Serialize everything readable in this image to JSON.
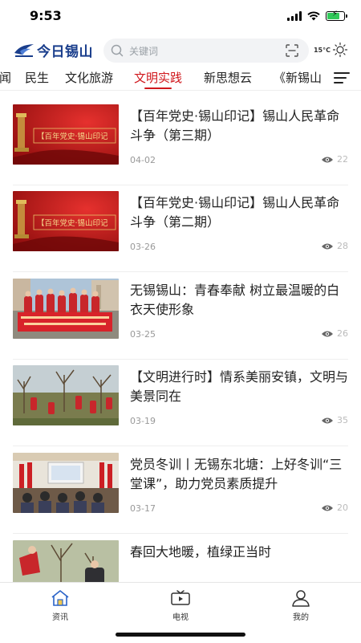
{
  "status_bar": {
    "time": "9:53"
  },
  "header": {
    "logo_text": "今日锡山",
    "search_placeholder": "关键词",
    "weather_temp": "15°C"
  },
  "tabs": [
    {
      "label": "闻"
    },
    {
      "label": "民生"
    },
    {
      "label": "文化旅游"
    },
    {
      "label": "文明实践",
      "active": true
    },
    {
      "label": "新思想云"
    },
    {
      "label": "《新锡山"
    }
  ],
  "news": [
    {
      "title": "【百年党史·锡山印记】锡山人民革命斗争（第三期）",
      "date": "04-02",
      "views": "22",
      "thumb_caption": "【百年党史·锡山印记"
    },
    {
      "title": "【百年党史·锡山印记】锡山人民革命斗争（第二期）",
      "date": "03-26",
      "views": "28",
      "thumb_caption": "【百年党史·锡山印记"
    },
    {
      "title": "无锡锡山：青春奉献 树立最温暖的白衣天使形象",
      "date": "03-25",
      "views": "26",
      "thumb_caption": ""
    },
    {
      "title": "【文明进行时】情系美丽安镇，文明与美景同在",
      "date": "03-19",
      "views": "35",
      "thumb_caption": ""
    },
    {
      "title": "党员冬训丨无锡东北塘：上好冬训“三堂课”，助力党员素质提升",
      "date": "03-17",
      "views": "20",
      "thumb_caption": ""
    },
    {
      "title": "春回大地暖，植绿正当时",
      "date": "",
      "views": "",
      "thumb_caption": ""
    }
  ],
  "bottom_nav": [
    {
      "label": "资讯",
      "icon": "home-icon",
      "active": true
    },
    {
      "label": "电视",
      "icon": "tv-icon"
    },
    {
      "label": "我的",
      "icon": "user-icon"
    }
  ],
  "colors": {
    "accent": "#d0171c",
    "brand": "#1a3e8c"
  }
}
